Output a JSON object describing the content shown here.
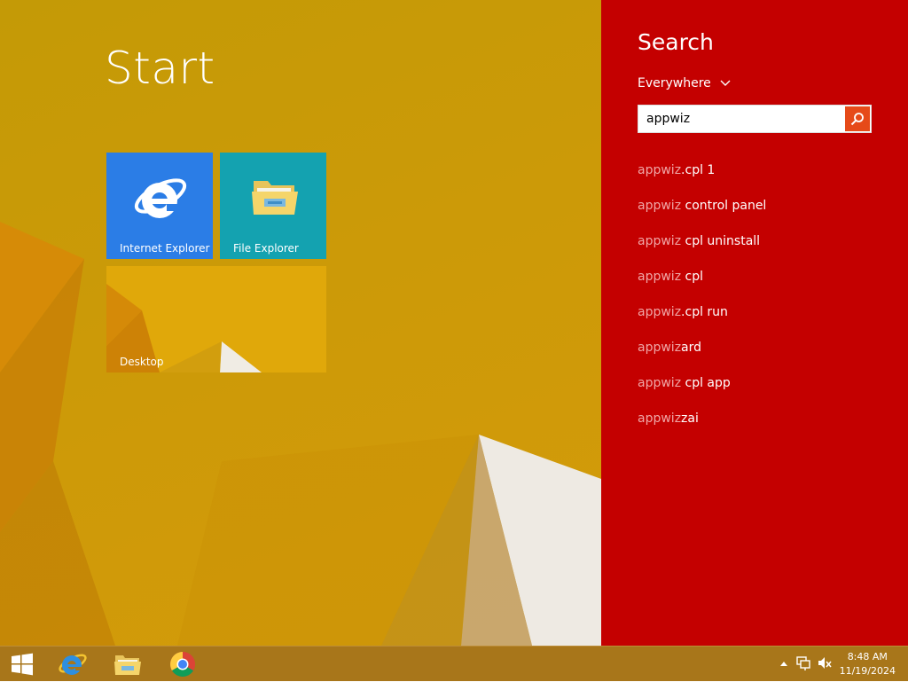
{
  "start": {
    "title": "Start",
    "tiles": [
      {
        "label": "Internet Explorer",
        "icon": "internet-explorer-icon",
        "color": "#2b7de6"
      },
      {
        "label": "File Explorer",
        "icon": "file-explorer-icon",
        "color": "#14a2b0"
      },
      {
        "label": "Desktop",
        "icon": "desktop-wallpaper-thumbnail",
        "color": "#e2a70c"
      }
    ]
  },
  "search_pane": {
    "title": "Search",
    "scope": "Everywhere",
    "query": "appwiz",
    "accent": "#c40000",
    "suggestions": [
      {
        "match": "appwiz",
        "rest": ".cpl 1"
      },
      {
        "match": "appwiz",
        "rest": " control panel"
      },
      {
        "match": "appwiz",
        "rest": " cpl uninstall"
      },
      {
        "match": "appwiz",
        "rest": " cpl"
      },
      {
        "match": "appwiz",
        "rest": ".cpl run"
      },
      {
        "match": "appwiz",
        "rest": "ard"
      },
      {
        "match": "appwiz",
        "rest": " cpl app"
      },
      {
        "match": "appwiz",
        "rest": "zai"
      }
    ]
  },
  "taskbar": {
    "pinned": [
      "windows-logo-icon",
      "internet-explorer-icon",
      "file-explorer-icon",
      "chrome-icon"
    ],
    "tray_icons": [
      "show-hidden-icons-arrow",
      "network-icon",
      "volume-muted-icon"
    ],
    "clock": {
      "time": "8:48 AM",
      "date": "11/19/2024"
    }
  }
}
